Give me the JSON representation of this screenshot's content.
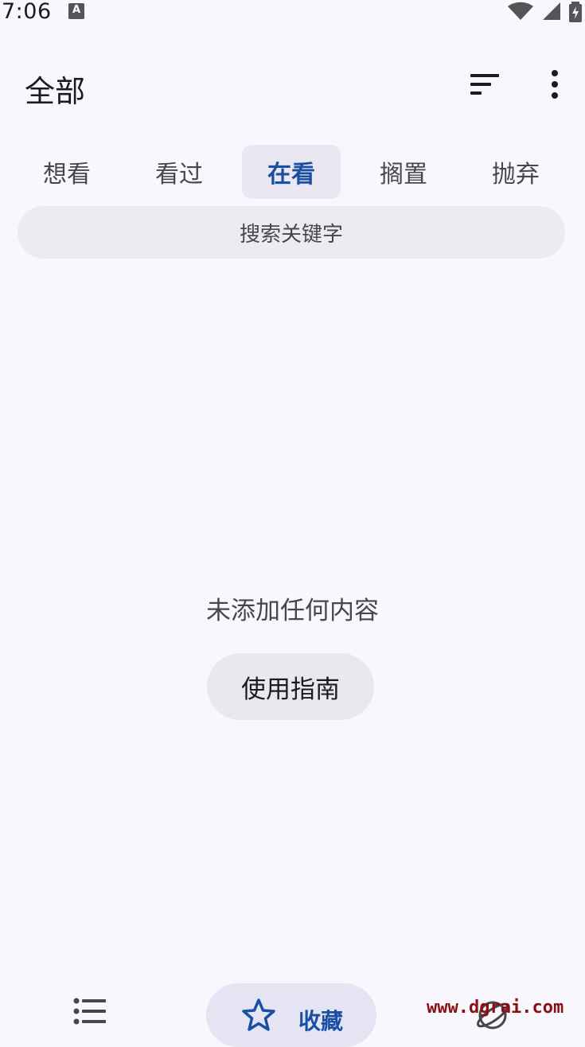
{
  "status_bar": {
    "time": "7:06",
    "notification_icon": "A"
  },
  "app_bar": {
    "title": "全部",
    "sort_icon": "sort-icon",
    "more_icon": "more-vert-icon"
  },
  "tabs": [
    {
      "label": "想看"
    },
    {
      "label": "看过"
    },
    {
      "label": "在看",
      "active": true
    },
    {
      "label": "搁置"
    },
    {
      "label": "抛弃"
    }
  ],
  "search": {
    "placeholder": "搜索关键字"
  },
  "empty_state": {
    "message": "未添加任何内容",
    "guide_button": "使用指南"
  },
  "bottom_nav": {
    "items": [
      {
        "icon": "list-icon"
      },
      {
        "icon": "star-icon",
        "label": "收藏",
        "active": true
      },
      {
        "icon": "explore-icon"
      }
    ]
  },
  "watermark": "www.dgrai.com",
  "colors": {
    "accent": "#1a4fa3",
    "background": "#f8f7fd",
    "surface": "#ecebf1"
  }
}
